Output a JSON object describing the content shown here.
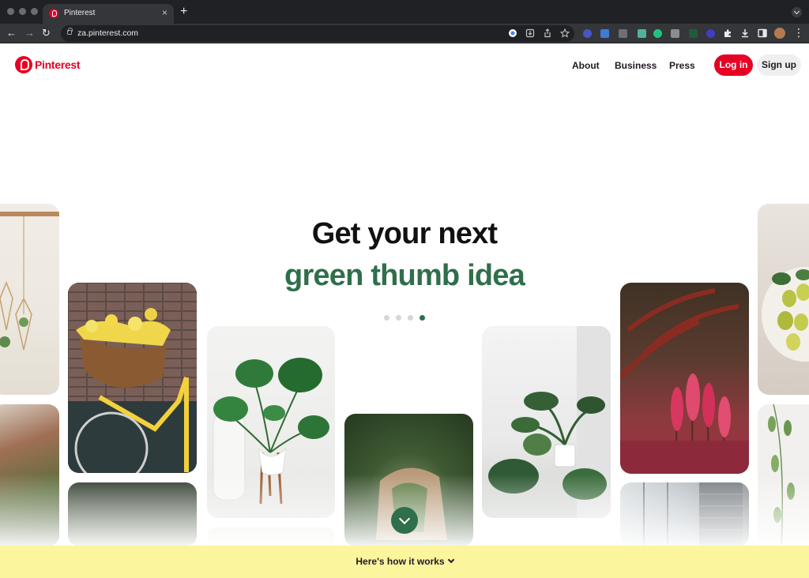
{
  "browser": {
    "tab_title": "Pinterest",
    "tab_close": "×",
    "new_tab": "+",
    "back": "←",
    "forward": "→",
    "reload": "↻",
    "url": "za.pinterest.com"
  },
  "header": {
    "logo_text": "Pinterest",
    "nav": {
      "about": "About",
      "business": "Business",
      "press": "Press"
    },
    "login_label": "Log in",
    "signup_label": "Sign up"
  },
  "hero": {
    "line1": "Get your next",
    "line2": "green thumb idea",
    "carousel_active_index": 4,
    "carousel_count": 4
  },
  "footer": {
    "how_it_works": "Here's how it works"
  },
  "colors": {
    "brand_red": "#e60023",
    "hero_green": "#2f6f4b",
    "banner_yellow": "#fbf59e"
  }
}
